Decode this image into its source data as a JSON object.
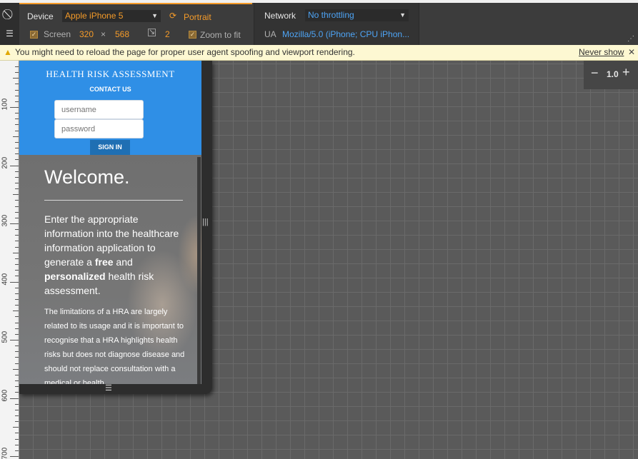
{
  "toolbar": {
    "device_label": "Device",
    "device_value": "Apple iPhone 5",
    "orientation_label": "Portrait",
    "screen_label": "Screen",
    "screen_width": "320",
    "screen_times": "×",
    "screen_height": "568",
    "dpr_value": "2",
    "zoom_to_fit_label": "Zoom to fit",
    "network_label": "Network",
    "network_value": "No throttling",
    "ua_label": "UA",
    "ua_value": "Mozilla/5.0 (iPhone; CPU iPhon..."
  },
  "warning": {
    "text": "You might need to reload the page for proper user agent spoofing and viewport rendering.",
    "never_show": "Never show"
  },
  "zoom": {
    "minus": "−",
    "value": "1.0",
    "plus": "+"
  },
  "ruler_labels": [
    "100",
    "200",
    "300",
    "400",
    "500",
    "600",
    "700"
  ],
  "page": {
    "title": "HEALTH RISK ASSESSMENT",
    "contact": "CONTACT US",
    "username_placeholder": "username",
    "password_placeholder": "password",
    "signin": "SIGN IN",
    "welcome": "Welcome.",
    "lead_1": "Enter the appropriate information into the healthcare information application to generate a ",
    "lead_free": "free",
    "lead_2": " and ",
    "lead_personalized": "personalized",
    "lead_3": " health risk assessment.",
    "small_text": "The limitations of a HRA are largely related to its usage and it is important to recognise that a HRA highlights health risks but does not diagnose disease and should not replace consultation with a medical or health"
  },
  "colors": {
    "accent": "#f59b29",
    "link_blue": "#4ea4f5",
    "header_blue": "#2f8fe6",
    "warning_bg": "#fdf8d2"
  }
}
